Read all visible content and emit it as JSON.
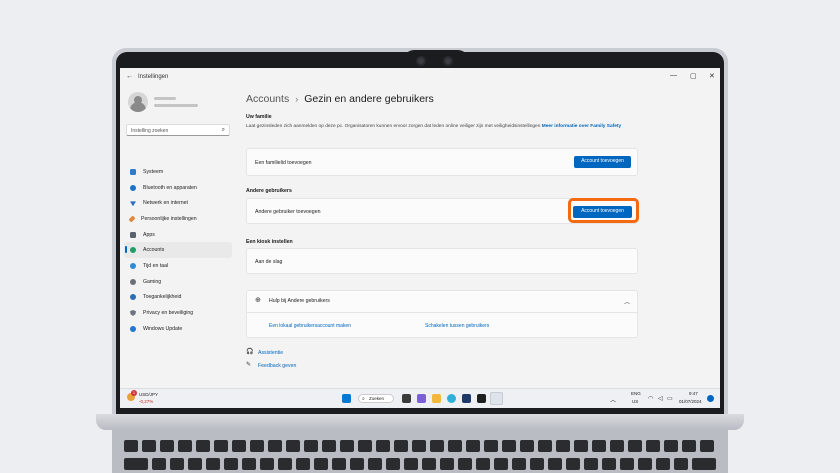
{
  "window": {
    "title": "Instellingen",
    "back_glyph": "←",
    "minimize_glyph": "—",
    "maximize_glyph": "▢",
    "close_glyph": "✕"
  },
  "sidebar": {
    "search_placeholder": "Instelling zoeken",
    "items": [
      {
        "label": "Systeem",
        "icon": "system-icon",
        "color": "#2b7bd1"
      },
      {
        "label": "Bluetooth en apparaten",
        "icon": "bluetooth-icon",
        "color": "#1a73c9"
      },
      {
        "label": "Netwerk en internet",
        "icon": "network-icon",
        "color": "#2c6fbf"
      },
      {
        "label": "Persoonlijke instellingen",
        "icon": "brush-icon",
        "color": "#e08a3c"
      },
      {
        "label": "Apps",
        "icon": "apps-icon",
        "color": "#5a6270"
      },
      {
        "label": "Accounts",
        "icon": "accounts-icon",
        "color": "#1f9e6a"
      },
      {
        "label": "Tijd en taal",
        "icon": "time-language-icon",
        "color": "#2c8ad6"
      },
      {
        "label": "Gaming",
        "icon": "gaming-icon",
        "color": "#6b6f78"
      },
      {
        "label": "Toegankelijkheid",
        "icon": "accessibility-icon",
        "color": "#2a6db8"
      },
      {
        "label": "Privacy en beveiliging",
        "icon": "shield-icon",
        "color": "#6d7480"
      },
      {
        "label": "Windows Update",
        "icon": "update-icon",
        "color": "#1f78d1"
      }
    ],
    "active_index": 5
  },
  "main": {
    "breadcrumb": {
      "parent": "Accounts",
      "separator": "›",
      "current": "Gezin en andere gebruikers"
    },
    "family": {
      "heading": "Uw familie",
      "description": "Laat gezinsleden zich aanmelden op deze pc. Organisatoren kunnen ervoor zorgen dat leden online veiliger zijn met veiligheidsinstellingen",
      "link": "Meer informatie over Family Safety",
      "row_label": "Een familielid toevoegen",
      "button": "Account toevoegen"
    },
    "other_users": {
      "heading": "Andere gebruikers",
      "row_label": "Andere gebruiker toevoegen",
      "button": "Account toevoegen"
    },
    "kiosk": {
      "heading": "Een kiosk instellen",
      "row_label": "Aan de slag"
    },
    "help": {
      "title": "Hulp bij Andere gebruikers",
      "links": [
        "Een lokaal gebruikersaccount maken",
        "Schakelen tussen gebruikers"
      ]
    },
    "footer": {
      "assist": "Assistentie",
      "feedback": "Feedback geven"
    }
  },
  "taskbar": {
    "ticker": "USD/JPY",
    "change": "-0,27%",
    "search": "Zoeken",
    "lang_top": "ENG",
    "lang_bottom": "US",
    "time": "9:47",
    "date": "01/07/2024",
    "badge": "1"
  },
  "colors": {
    "accent": "#0067c0",
    "highlight": "#f36a10"
  }
}
